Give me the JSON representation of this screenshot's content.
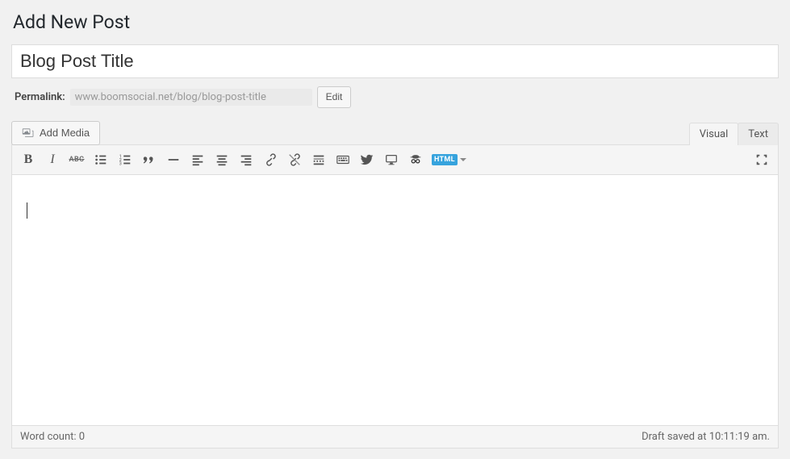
{
  "page": {
    "title": "Add New Post"
  },
  "post": {
    "title": "Blog Post Title"
  },
  "permalink": {
    "label": "Permalink:",
    "url": "www.boomsocial.net/blog/blog-post-title",
    "edit_label": "Edit"
  },
  "media": {
    "add_label": "Add Media"
  },
  "tabs": {
    "visual": "Visual",
    "text": "Text"
  },
  "toolbar": {
    "bold": "B",
    "italic": "I",
    "strike": "ABC",
    "html_badge": "HTML"
  },
  "status": {
    "word_count_label": "Word count: ",
    "word_count": "0",
    "save_status": "Draft saved at 10:11:19 am."
  }
}
